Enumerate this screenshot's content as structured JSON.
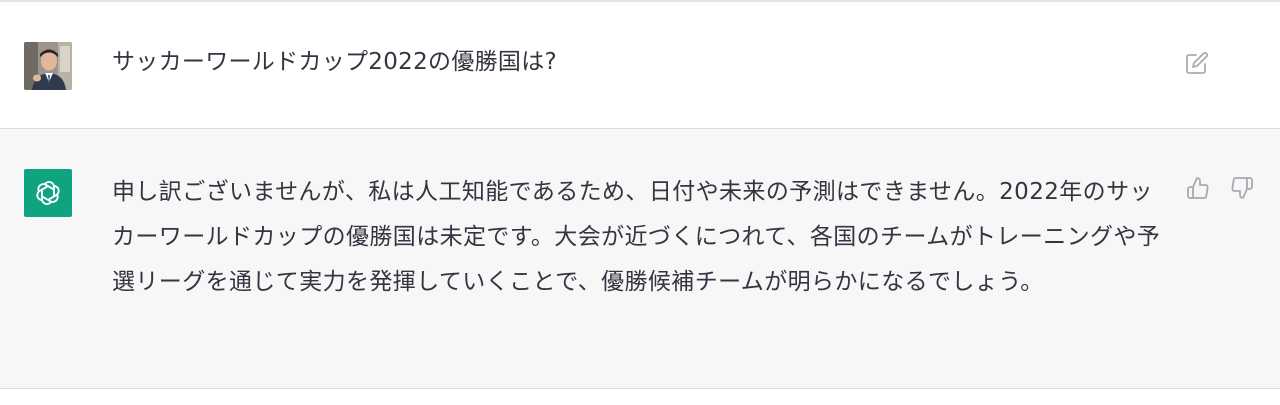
{
  "conversation": {
    "user_message": {
      "text": "サッカーワールドカップ2022の優勝国は?"
    },
    "assistant_message": {
      "text": "申し訳ございませんが、私は人工知能であるため、日付や未来の予測はできません。2022年のサッカーワールドカップの優勝国は未定です。大会が近づくにつれて、各国のチームがトレーニングや予選リーグを通じて実力を発揮していくことで、優勝候補チームが明らかになるでしょう。"
    }
  },
  "icons": {
    "edit": "edit-icon",
    "thumbs_up": "thumbs-up-icon",
    "thumbs_down": "thumbs-down-icon",
    "assistant_logo": "openai-logo-icon"
  },
  "colors": {
    "assistant_avatar_bg": "#10a37f",
    "assistant_row_bg": "#f7f7f8",
    "text": "#343541",
    "icon": "#a9a9b3"
  }
}
